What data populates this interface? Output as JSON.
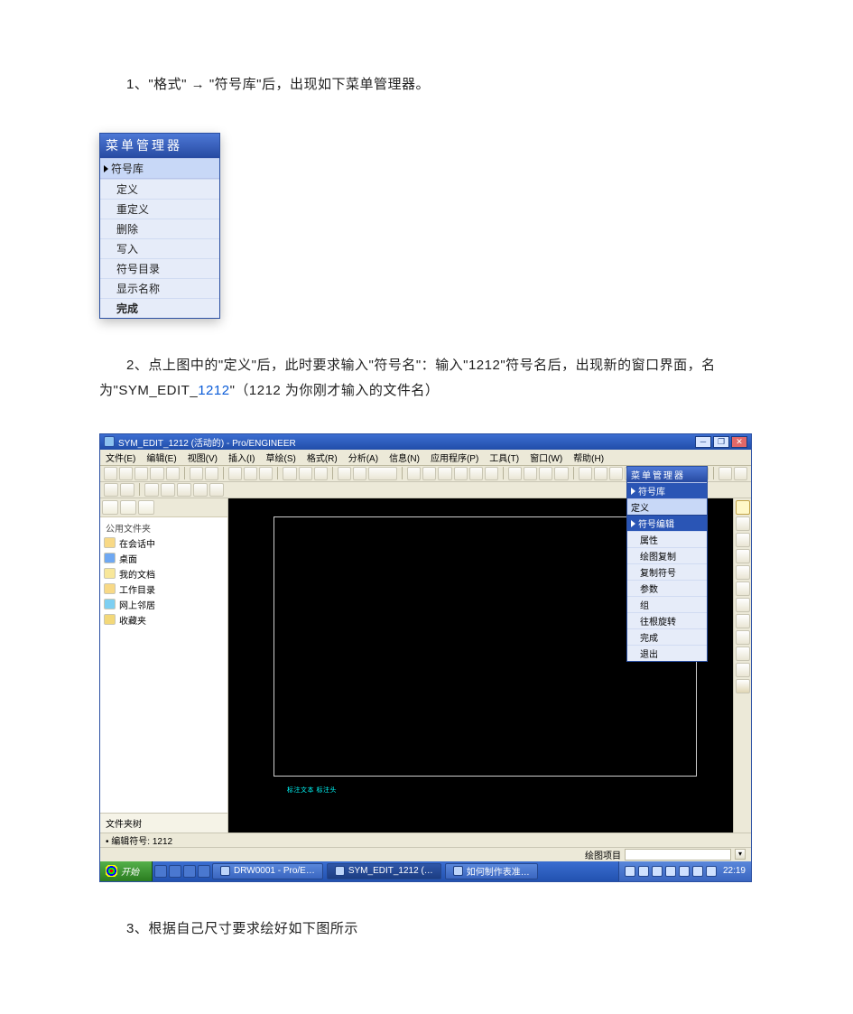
{
  "paras": {
    "p1": "1、\"格式\" → \"符号库\"后，出现如下菜单管理器。",
    "p2_a": "2、点上图中的\"定义\"后，此时要求输入\"符号名\"：输入\"1212\"符号名后，出现新的窗口界面，名为\"SYM_EDIT_",
    "p2_link": "1212",
    "p2_b": "\"（1212 为你刚才输入的文件名）",
    "p3": "3、根据自己尺寸要求绘好如下图所示"
  },
  "menu_manager": {
    "title": "菜单管理器",
    "section": "符号库",
    "items": [
      "定义",
      "重定义",
      "删除",
      "写入",
      "符号目录",
      "显示名称",
      "完成"
    ]
  },
  "shot": {
    "title": "SYM_EDIT_1212 (活动的) - Pro/ENGINEER",
    "menubar": [
      "文件(E)",
      "编辑(E)",
      "视图(V)",
      "插入(I)",
      "草绘(S)",
      "格式(R)",
      "分析(A)",
      "信息(N)",
      "应用程序(P)",
      "工具(T)",
      "窗口(W)",
      "帮助(H)"
    ],
    "sidebar": {
      "header": "公用文件夹",
      "items": [
        {
          "icon": "ic-folder",
          "label": "在会话中"
        },
        {
          "icon": "ic-desk",
          "label": "桌面"
        },
        {
          "icon": "ic-doc",
          "label": "我的文档"
        },
        {
          "icon": "ic-folder",
          "label": "工作目录"
        },
        {
          "icon": "ic-net",
          "label": "网上邻居"
        },
        {
          "icon": "ic-star",
          "label": "收藏夹"
        }
      ],
      "footer": "文件夹树"
    },
    "mm2": {
      "title": "菜单管理器",
      "sec1": "符号库",
      "sel1": "定义",
      "sec2": "符号编辑",
      "items": [
        "属性",
        "绘图复制",
        "复制符号",
        "参数",
        "组",
        "往根旋转",
        "完成",
        "退出"
      ]
    },
    "status_left": "• 编辑符号:  1212",
    "status_field_label": "绘图项目",
    "canvas_scribble": "标注文本   标注头"
  },
  "taskbar": {
    "start": "开始",
    "tasks": [
      "DRW0001 - Pro/E…",
      "SYM_EDIT_1212 (…",
      "如何制作表准…"
    ],
    "clock": "22:19"
  }
}
